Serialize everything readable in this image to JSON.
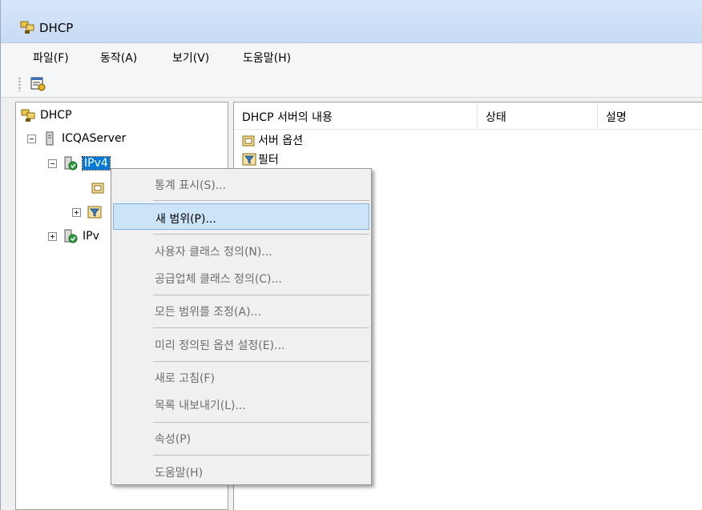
{
  "window": {
    "title": "DHCP"
  },
  "menubar": {
    "items": [
      {
        "label": "파일(F)"
      },
      {
        "label": "동작(A)"
      },
      {
        "label": "보기(V)"
      },
      {
        "label": "도움말(H)"
      }
    ]
  },
  "toolbar": {
    "buttons": [
      {
        "icon": "properties-icon"
      }
    ]
  },
  "tree": {
    "root": "DHCP",
    "server": "ICQAServer",
    "ipv4": "IPv4",
    "ipv6": "IPv"
  },
  "list": {
    "columns": [
      "DHCP 서버의 내용",
      "상태",
      "설명"
    ],
    "rows": [
      {
        "label": "서버 옵션",
        "icon": "server-options-icon"
      },
      {
        "label": "필터",
        "icon": "filter-icon"
      }
    ]
  },
  "context_menu": {
    "items": [
      {
        "label": "통계 표시(S)...",
        "enabled": false
      },
      {
        "label": "새 범위(P)...",
        "enabled": true,
        "highlighted": true
      },
      {
        "label": "사용자 클래스 정의(N)...",
        "enabled": false
      },
      {
        "label": "공급업체 클래스 정의(C)...",
        "enabled": false
      },
      {
        "label": "모든 범위를 조정(A)...",
        "enabled": false
      },
      {
        "label": "미리 정의된 옵션 설정(E)...",
        "enabled": false
      },
      {
        "label": "새로 고침(F)",
        "enabled": false
      },
      {
        "label": "목록 내보내기(L)...",
        "enabled": false
      },
      {
        "label": "속성(P)",
        "enabled": false
      },
      {
        "label": "도움말(H)",
        "enabled": false
      }
    ]
  },
  "colors": {
    "selection": "#0078d7",
    "menu_highlight": "#cce4f7",
    "menu_highlight_border": "#7ab3e0",
    "disabled_text": "#6d6d6d"
  }
}
